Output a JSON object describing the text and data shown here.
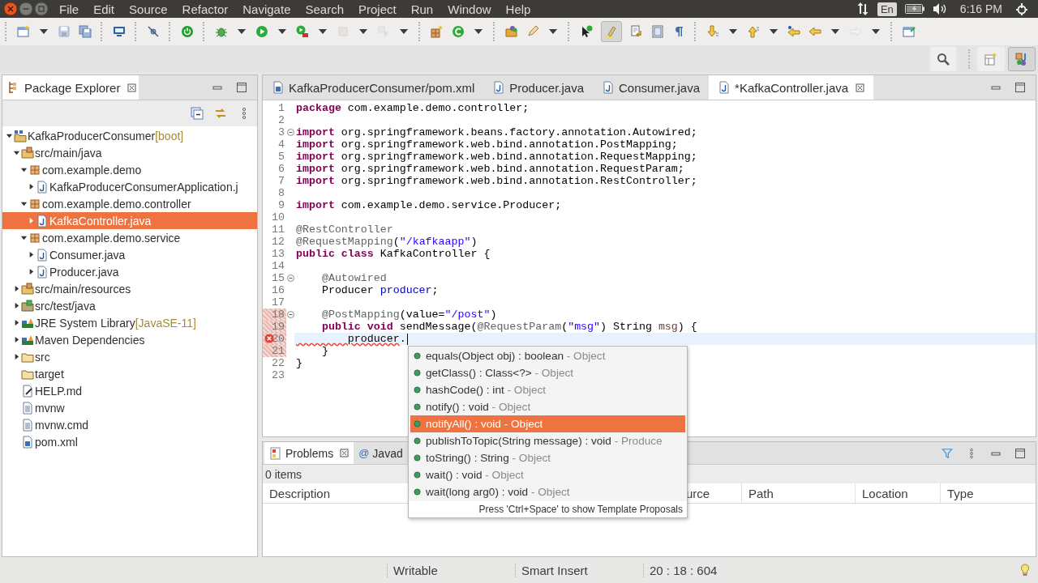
{
  "menu": [
    "File",
    "Edit",
    "Source",
    "Refactor",
    "Navigate",
    "Search",
    "Project",
    "Run",
    "Window",
    "Help"
  ],
  "tray": {
    "keyboard": "En",
    "clock": "6:16 PM"
  },
  "toolbar": {
    "toggles": [
      {
        "on": true
      }
    ]
  },
  "perspectives": [
    {
      "selected": false
    },
    {
      "selected": true
    }
  ],
  "package_explorer": {
    "title": "Package Explorer",
    "tree": [
      {
        "label": "KafkaProducerConsumer",
        "suffix": "[boot]",
        "kind": "project",
        "expandable": true,
        "expanded": true,
        "selected": false,
        "children": [
          {
            "label": "src/main/java",
            "kind": "source-folder",
            "expandable": true,
            "expanded": true,
            "selected": false,
            "children": [
              {
                "label": "com.example.demo",
                "kind": "package",
                "expandable": true,
                "expanded": true,
                "selected": false,
                "children": [
                  {
                    "label": "KafkaProducerConsumerApplication.j",
                    "kind": "java",
                    "expandable": true,
                    "expanded": false,
                    "selected": false
                  }
                ]
              },
              {
                "label": "com.example.demo.controller",
                "kind": "package",
                "expandable": true,
                "expanded": true,
                "selected": false,
                "children": [
                  {
                    "label": "KafkaController.java",
                    "kind": "java",
                    "expandable": true,
                    "expanded": false,
                    "selected": true
                  }
                ]
              },
              {
                "label": "com.example.demo.service",
                "kind": "package",
                "expandable": true,
                "expanded": true,
                "selected": false,
                "children": [
                  {
                    "label": "Consumer.java",
                    "kind": "java",
                    "expandable": true,
                    "expanded": false,
                    "selected": false
                  },
                  {
                    "label": "Producer.java",
                    "kind": "java",
                    "expandable": true,
                    "expanded": false,
                    "selected": false
                  }
                ]
              }
            ]
          },
          {
            "label": "src/main/resources",
            "kind": "source-folder",
            "expandable": true,
            "expanded": false,
            "selected": false
          },
          {
            "label": "src/test/java",
            "kind": "test-folder",
            "expandable": true,
            "expanded": false,
            "selected": false
          },
          {
            "label": "JRE System Library",
            "suffix": "[JavaSE-11]",
            "kind": "library",
            "expandable": true,
            "expanded": false,
            "selected": false
          },
          {
            "label": "Maven Dependencies",
            "kind": "library",
            "expandable": true,
            "expanded": false,
            "selected": false
          },
          {
            "label": "src",
            "kind": "folder",
            "expandable": true,
            "expanded": false,
            "selected": false
          },
          {
            "label": "target",
            "kind": "folder",
            "expandable": false,
            "expanded": false,
            "selected": false
          },
          {
            "label": "HELP.md",
            "kind": "markdown",
            "expandable": false,
            "expanded": false,
            "selected": false
          },
          {
            "label": "mvnw",
            "kind": "text",
            "expandable": false,
            "expanded": false,
            "selected": false
          },
          {
            "label": "mvnw.cmd",
            "kind": "text",
            "expandable": false,
            "expanded": false,
            "selected": false
          },
          {
            "label": "pom.xml",
            "kind": "maven",
            "expandable": false,
            "expanded": false,
            "selected": false
          }
        ]
      }
    ]
  },
  "editor": {
    "tabs": [
      {
        "label": "KafkaProducerConsumer/pom.xml",
        "kind": "maven",
        "selected": false
      },
      {
        "label": "Producer.java",
        "kind": "java",
        "selected": false
      },
      {
        "label": "Consumer.java",
        "kind": "java",
        "selected": false
      },
      {
        "label": "*KafkaController.java",
        "kind": "java",
        "selected": true
      }
    ],
    "lines": [
      {
        "n": "1",
        "fold": false,
        "error": false,
        "changed": false,
        "current": false,
        "segs": [
          {
            "kind": "keyword",
            "text": "package "
          },
          {
            "kind": "plain",
            "text": "com.example.demo.controller;"
          }
        ]
      },
      {
        "n": "2",
        "fold": false,
        "error": false,
        "changed": false,
        "current": false
      },
      {
        "n": "3",
        "fold": true,
        "error": false,
        "changed": false,
        "current": false,
        "segs": [
          {
            "kind": "keyword",
            "text": "import "
          },
          {
            "kind": "plain",
            "text": "org.springframework.beans.factory.annotation.Autowired;"
          }
        ]
      },
      {
        "n": "4",
        "fold": false,
        "error": false,
        "changed": false,
        "current": false,
        "segs": [
          {
            "kind": "keyword",
            "text": "import "
          },
          {
            "kind": "plain",
            "text": "org.springframework.web.bind.annotation.PostMapping;"
          }
        ]
      },
      {
        "n": "5",
        "fold": false,
        "error": false,
        "changed": false,
        "current": false,
        "segs": [
          {
            "kind": "keyword",
            "text": "import "
          },
          {
            "kind": "plain",
            "text": "org.springframework.web.bind.annotation.RequestMapping;"
          }
        ]
      },
      {
        "n": "6",
        "fold": false,
        "error": false,
        "changed": false,
        "current": false,
        "segs": [
          {
            "kind": "keyword",
            "text": "import "
          },
          {
            "kind": "plain",
            "text": "org.springframework.web.bind.annotation.RequestParam;"
          }
        ]
      },
      {
        "n": "7",
        "fold": false,
        "error": false,
        "changed": false,
        "current": false,
        "segs": [
          {
            "kind": "keyword",
            "text": "import "
          },
          {
            "kind": "plain",
            "text": "org.springframework.web.bind.annotation.RestController;"
          }
        ]
      },
      {
        "n": "8",
        "fold": false,
        "error": false,
        "changed": false,
        "current": false
      },
      {
        "n": "9",
        "fold": false,
        "error": false,
        "changed": false,
        "current": false,
        "segs": [
          {
            "kind": "keyword",
            "text": "import "
          },
          {
            "kind": "plain",
            "text": "com.example.demo.service.Producer;"
          }
        ]
      },
      {
        "n": "10",
        "fold": false,
        "error": false,
        "changed": false,
        "current": false
      },
      {
        "n": "11",
        "fold": false,
        "error": false,
        "changed": false,
        "current": false,
        "segs": [
          {
            "kind": "annotation",
            "text": "@RestController"
          }
        ]
      },
      {
        "n": "12",
        "fold": false,
        "error": false,
        "changed": false,
        "current": false,
        "segs": [
          {
            "kind": "annotation",
            "text": "@RequestMapping"
          },
          {
            "kind": "plain",
            "text": "("
          },
          {
            "kind": "string",
            "text": "\"/kafkaapp\""
          },
          {
            "kind": "plain",
            "text": ")"
          }
        ]
      },
      {
        "n": "13",
        "fold": false,
        "error": false,
        "changed": false,
        "current": false,
        "segs": [
          {
            "kind": "keyword",
            "text": "public class "
          },
          {
            "kind": "plain",
            "text": "KafkaController {"
          }
        ]
      },
      {
        "n": "14",
        "fold": false,
        "error": false,
        "changed": false,
        "current": false
      },
      {
        "n": "15",
        "fold": true,
        "error": false,
        "changed": false,
        "current": false,
        "segs": [
          {
            "kind": "annotation",
            "text": "    @Autowired"
          }
        ]
      },
      {
        "n": "16",
        "fold": false,
        "error": false,
        "changed": false,
        "current": false,
        "segs": [
          {
            "kind": "plain",
            "text": "    Producer "
          },
          {
            "kind": "field",
            "text": "producer"
          },
          {
            "kind": "plain",
            "text": ";"
          }
        ]
      },
      {
        "n": "17",
        "fold": false,
        "error": false,
        "changed": false,
        "current": false
      },
      {
        "n": "18",
        "fold": true,
        "error": false,
        "changed": true,
        "current": false,
        "segs": [
          {
            "kind": "annotation",
            "text": "    @PostMapping"
          },
          {
            "kind": "plain",
            "text": "(value="
          },
          {
            "kind": "string",
            "text": "\"/post\""
          },
          {
            "kind": "plain",
            "text": ")"
          }
        ]
      },
      {
        "n": "19",
        "fold": false,
        "error": false,
        "changed": true,
        "current": false,
        "segs": [
          {
            "kind": "keyword",
            "text": "    public void "
          },
          {
            "kind": "plain",
            "text": "sendMessage("
          },
          {
            "kind": "annotation",
            "text": "@RequestParam"
          },
          {
            "kind": "plain",
            "text": "("
          },
          {
            "kind": "string",
            "text": "\"msg\""
          },
          {
            "kind": "plain",
            "text": ") String "
          },
          {
            "kind": "param",
            "text": "msg"
          },
          {
            "kind": "plain",
            "text": ") {"
          }
        ]
      },
      {
        "n": "20",
        "fold": false,
        "error": true,
        "changed": true,
        "current": true,
        "segs": [
          {
            "kind": "error",
            "text": "        producer"
          },
          {
            "kind": "plain",
            "text": "."
          }
        ]
      },
      {
        "n": "21",
        "fold": false,
        "error": false,
        "changed": true,
        "current": false,
        "segs": [
          {
            "kind": "plain",
            "text": "    }"
          }
        ]
      },
      {
        "n": "22",
        "fold": false,
        "error": false,
        "changed": false,
        "current": false,
        "segs": [
          {
            "kind": "plain",
            "text": "}"
          }
        ]
      },
      {
        "n": "23",
        "fold": false,
        "error": false,
        "changed": false,
        "current": false
      }
    ],
    "completion": {
      "items": [
        {
          "sig": "equals(Object obj) : boolean",
          "owner": "- Object",
          "selected": false
        },
        {
          "sig": "getClass() : Class<?>",
          "owner": "- Object",
          "selected": false
        },
        {
          "sig": "hashCode() : int",
          "owner": "- Object",
          "selected": false
        },
        {
          "sig": "notify() : void",
          "owner": "- Object",
          "selected": false
        },
        {
          "sig": "notifyAll() : void",
          "owner": "- Object",
          "selected": true
        },
        {
          "sig": "publishToTopic(String message) : void",
          "owner": "- Produce",
          "selected": false
        },
        {
          "sig": "toString() : String",
          "owner": "- Object",
          "selected": false
        },
        {
          "sig": "wait() : void",
          "owner": "- Object",
          "selected": false
        },
        {
          "sig": "wait(long arg0) : void",
          "owner": "- Object",
          "selected": false
        }
      ],
      "footer": "Press 'Ctrl+Space' to show Template Proposals"
    }
  },
  "bottom_panel": {
    "tabs": [
      {
        "label": "Problems",
        "kind": "problems",
        "selected": true
      },
      {
        "label": "Javad",
        "kind": "javadoc",
        "icon": "@",
        "selected": false
      }
    ],
    "summary": "0 items",
    "columns": [
      "Description",
      "urce",
      "Path",
      "Location",
      "Type"
    ]
  },
  "status_bar": [
    "Writable",
    "Smart Insert",
    "20 : 18 : 604"
  ]
}
